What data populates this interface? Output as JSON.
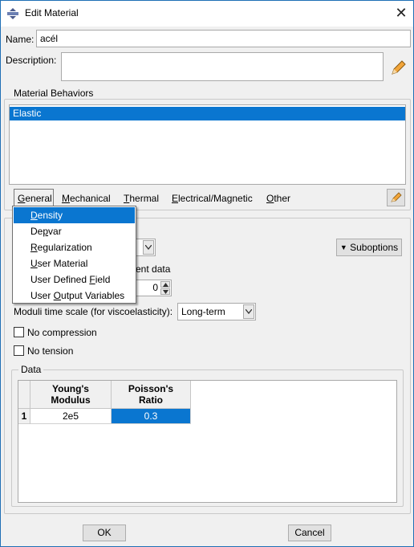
{
  "window": {
    "title": "Edit Material",
    "close_glyph": "✕"
  },
  "name": {
    "label": "Name:",
    "value": "acél"
  },
  "description": {
    "label": "Description:",
    "value": ""
  },
  "behaviors": {
    "group_label": "Material Behaviors",
    "items": [
      "Elastic"
    ]
  },
  "menubar": {
    "items": [
      {
        "pre": "",
        "u": "G",
        "post": "eneral"
      },
      {
        "pre": "",
        "u": "M",
        "post": "echanical"
      },
      {
        "pre": "",
        "u": "T",
        "post": "hermal"
      },
      {
        "pre": "",
        "u": "E",
        "post": "lectrical/Magnetic"
      },
      {
        "pre": "",
        "u": "O",
        "post": "ther"
      }
    ]
  },
  "general_menu": {
    "items": [
      {
        "pre": "",
        "u": "D",
        "post": "ensity",
        "selected": true
      },
      {
        "pre": "De",
        "u": "p",
        "post": "var",
        "selected": false
      },
      {
        "pre": "",
        "u": "R",
        "post": "egularization",
        "selected": false
      },
      {
        "pre": "",
        "u": "U",
        "post": "ser Material",
        "selected": false
      },
      {
        "pre": "User Defined ",
        "u": "F",
        "post": "ield",
        "selected": false
      },
      {
        "pre": "User ",
        "u": "O",
        "post": "utput Variables",
        "selected": false
      }
    ]
  },
  "elastic": {
    "suboptions_label": "Suboptions",
    "partial_text": "ent data",
    "spinner_value": "0",
    "moduli_label": "Moduli time scale (for viscoelasticity):",
    "moduli_value": "Long-term",
    "no_compression": "No compression",
    "no_tension": "No tension",
    "data_label": "Data"
  },
  "table": {
    "headers": [
      "Young's\nModulus",
      "Poisson's\nRatio"
    ],
    "rows": [
      {
        "index": "1",
        "values": [
          "2e5",
          "0.3"
        ]
      }
    ]
  },
  "footer": {
    "ok_label": "OK",
    "cancel_label": "Cancel"
  },
  "colors": {
    "selection": "#0a76d0",
    "frame": "#1f6fb5"
  }
}
